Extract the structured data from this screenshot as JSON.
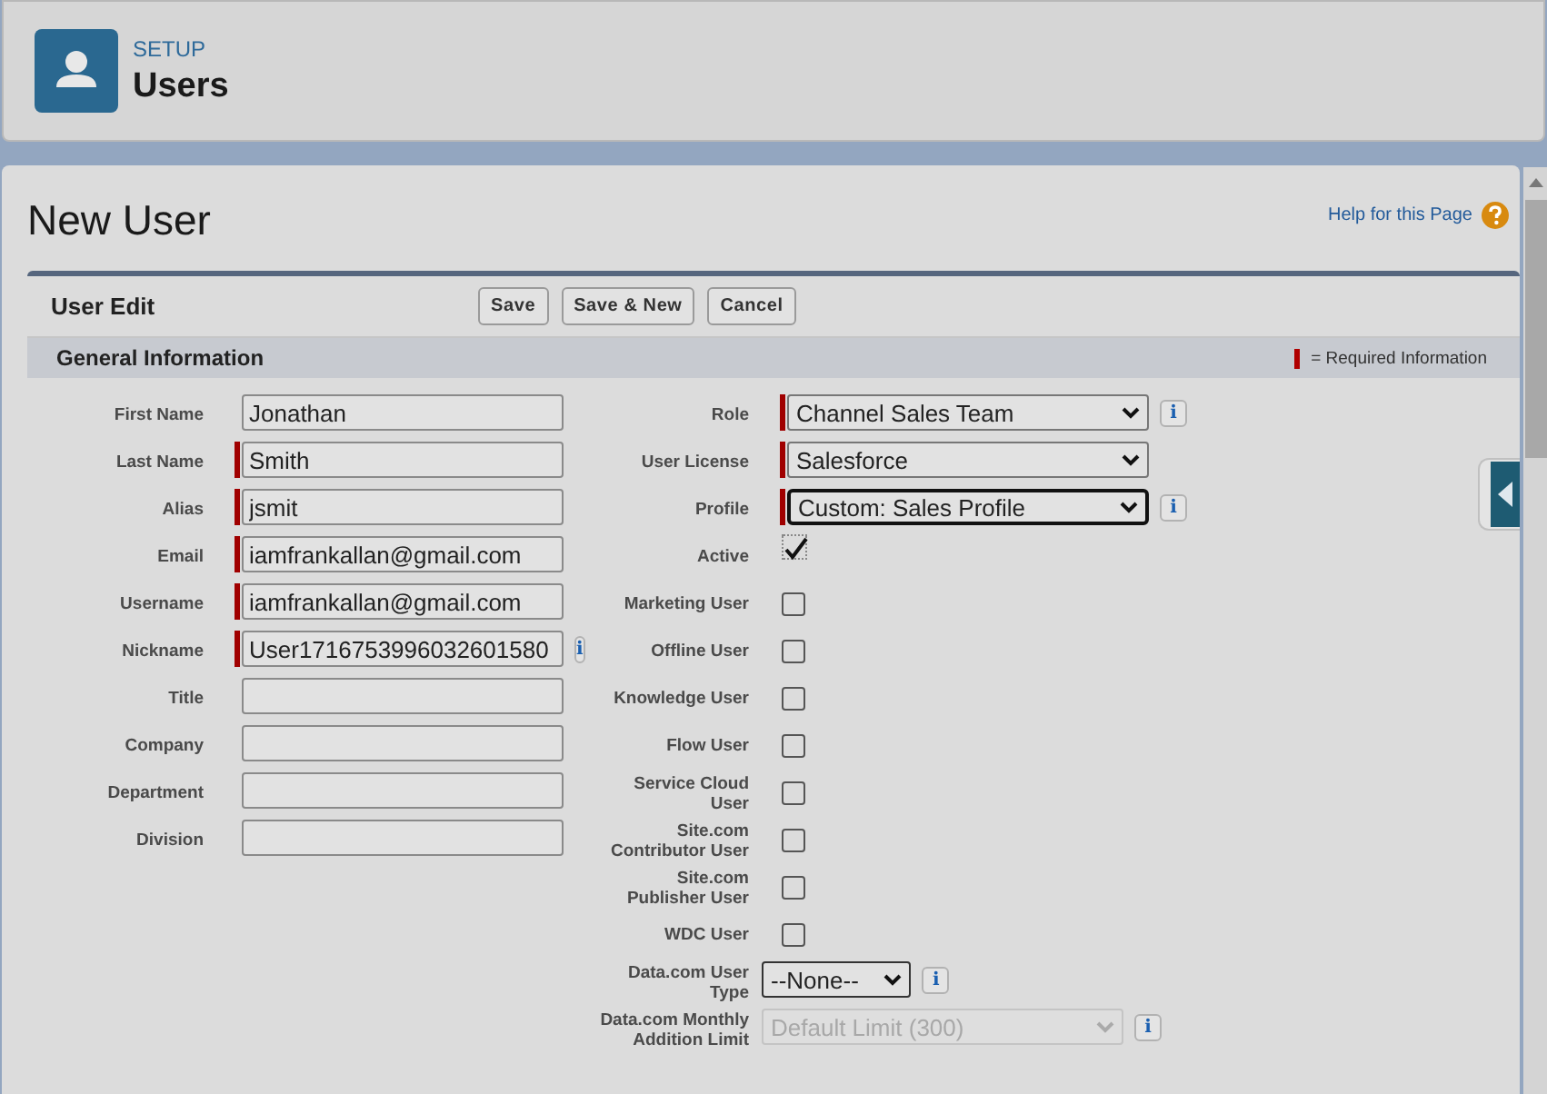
{
  "header": {
    "section": "SETUP",
    "title": "Users"
  },
  "page_title": "New User",
  "help_link": "Help for this Page",
  "block": {
    "title": "User Edit",
    "buttons": [
      "Save",
      "Save & New",
      "Cancel"
    ]
  },
  "section": {
    "title": "General Information",
    "required_legend": "= Required Information"
  },
  "left_fields": [
    {
      "label": "First Name",
      "value": "Jonathan",
      "required": false
    },
    {
      "label": "Last Name",
      "value": "Smith",
      "required": true
    },
    {
      "label": "Alias",
      "value": "jsmit",
      "required": true
    },
    {
      "label": "Email",
      "value": "iamfrankallan@gmail.com",
      "required": true
    },
    {
      "label": "Username",
      "value": "iamfrankallan@gmail.com",
      "required": true
    },
    {
      "label": "Nickname",
      "value": "User1716753996032601580",
      "required": true,
      "info": "i"
    },
    {
      "label": "Title",
      "required": false
    },
    {
      "label": "Company",
      "required": false
    },
    {
      "label": "Department",
      "required": false
    },
    {
      "label": "Division",
      "required": false
    }
  ],
  "right_fields": [
    {
      "label": "Role",
      "kind": "select",
      "value": "Channel Sales Team",
      "required": true,
      "info": "i"
    },
    {
      "label": "User License",
      "kind": "select",
      "value": "Salesforce",
      "required": true
    },
    {
      "label": "Profile",
      "kind": "select",
      "value": "Custom: Sales Profile",
      "required": true,
      "focused": true,
      "info": "i"
    },
    {
      "label": "Active",
      "kind": "checkbox",
      "checked": true
    },
    {
      "label": "Marketing User",
      "kind": "checkbox",
      "checked": false
    },
    {
      "label": "Offline User",
      "kind": "checkbox",
      "checked": false
    },
    {
      "label": "Knowledge User",
      "kind": "checkbox",
      "checked": false
    },
    {
      "label": "Flow User",
      "kind": "checkbox",
      "checked": false
    },
    {
      "label": "Service Cloud User",
      "kind": "checkbox",
      "checked": false
    },
    {
      "label": "Site.com Contributor User",
      "kind": "checkbox",
      "checked": false
    },
    {
      "label": "Site.com Publisher User",
      "kind": "checkbox",
      "checked": false
    },
    {
      "label": "WDC User",
      "kind": "checkbox",
      "checked": false
    },
    {
      "label": "Data.com User Type",
      "kind": "select",
      "value": "--None--",
      "required": false,
      "info": "i"
    },
    {
      "label": "Data.com Monthly Addition Limit",
      "kind": "select",
      "value": "Default Limit (300)",
      "required": false,
      "disabled": true,
      "info": "i"
    }
  ]
}
